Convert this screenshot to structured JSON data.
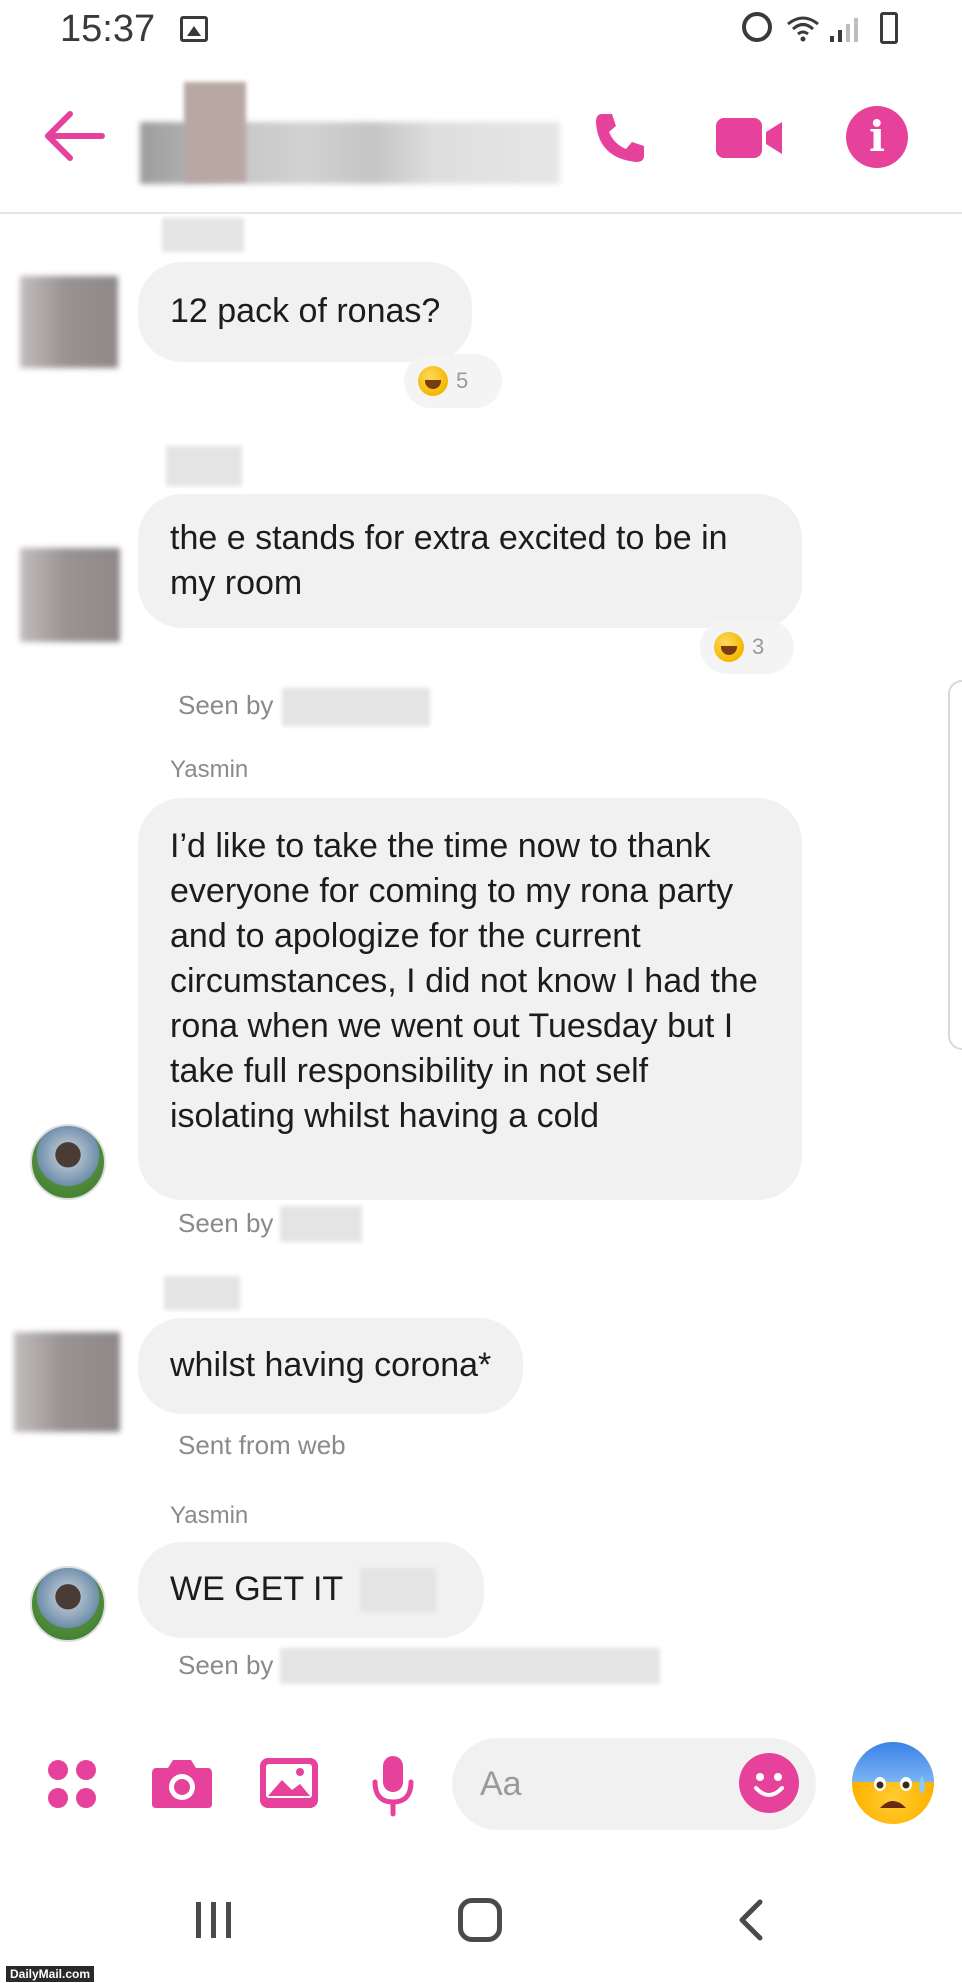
{
  "status_bar": {
    "time": "15:37"
  },
  "header": {
    "icons": [
      "back-arrow-icon",
      "phone-icon",
      "video-camera-icon",
      "info-icon"
    ],
    "info_glyph": "i",
    "accent_color": "#e6419b"
  },
  "messages": [
    {
      "text": "12 pack of ronas?",
      "reaction_emoji": "laughing-face",
      "reaction_count": "5"
    },
    {
      "text": "the e stands for extra excited to be in my room",
      "reaction_emoji": "laughing-face",
      "reaction_count": "3",
      "seen_label": "Seen by"
    },
    {
      "sender": "Yasmin",
      "text": "I’d like to take the time now to thank everyone for coming to my rona party and to apologize for the current circumstances, I did not know I had the rona when we went out Tuesday but I take full responsibility in not self isolating whilst having a cold",
      "seen_label": "Seen by"
    },
    {
      "text": "whilst having corona*",
      "status": "Sent from web"
    },
    {
      "sender": "Yasmin",
      "text": "WE GET IT",
      "seen_label": "Seen by"
    }
  ],
  "composer": {
    "placeholder": "Aa",
    "icons": [
      "apps-grid-icon",
      "camera-icon",
      "image-icon",
      "microphone-icon",
      "emoji-smile-icon",
      "anxious-face-emoji"
    ]
  },
  "nav_bar": {
    "icons": [
      "recent-apps-icon",
      "home-icon",
      "back-chevron-icon"
    ]
  },
  "watermark": "DailyMail.com"
}
